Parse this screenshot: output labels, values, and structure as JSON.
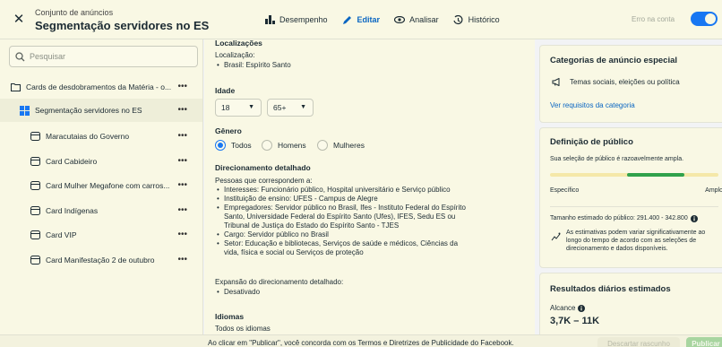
{
  "header": {
    "close_icon": "close-icon",
    "subtitle": "Conjunto de anúncios",
    "title": "Segmentação servidores no ES",
    "tabs": [
      {
        "label": "Desempenho",
        "icon": "bar-chart-icon"
      },
      {
        "label": "Editar",
        "icon": "pencil-icon",
        "active": true
      },
      {
        "label": "Analisar",
        "icon": "eye-icon"
      },
      {
        "label": "Histórico",
        "icon": "history-icon"
      }
    ],
    "error_label": "Erro na conta",
    "toggle_on": true,
    "accent_color": "#1877f2"
  },
  "sidebar": {
    "search_placeholder": "Pesquisar",
    "items": [
      {
        "label": "Cards de desdobramentos da Matéria - o...",
        "icon": "folder-icon",
        "level": 0
      },
      {
        "label": "Segmentação servidores no ES",
        "icon": "grid-icon",
        "level": 1,
        "selected": true
      },
      {
        "label": "Maracutaias do Governo",
        "icon": "ad-card-icon",
        "level": 2
      },
      {
        "label": "Card Cabideiro",
        "icon": "ad-card-icon",
        "level": 2
      },
      {
        "label": "Card Mulher Megafone com carros...",
        "icon": "ad-card-icon",
        "level": 2
      },
      {
        "label": "Card Indígenas",
        "icon": "ad-card-icon",
        "level": 2
      },
      {
        "label": "Card VIP",
        "icon": "ad-card-icon",
        "level": 2
      },
      {
        "label": "Card Manifestação 2 de outubro",
        "icon": "ad-card-icon",
        "level": 2
      }
    ],
    "more_label": "•••"
  },
  "main": {
    "locations_title": "Localizações",
    "location_label": "Localização:",
    "location_value": "Brasil: Espírito Santo",
    "age_title": "Idade",
    "age_min": "18",
    "age_max": "65+",
    "gender_title": "Gênero",
    "gender_options": [
      "Todos",
      "Homens",
      "Mulheres"
    ],
    "gender_selected": "Todos",
    "detailed_title": "Direcionamento detalhado",
    "detailed_intro": "Pessoas que correspondem a:",
    "detailed_items": [
      "Interesses: Funcionário público, Hospital universitário e Serviço público",
      "Instituição de ensino: UFES - Campus de Alegre",
      "Empregadores: Servidor público no Brasil, Ifes - Instituto Federal do Espírito",
      "Santo, Universidade Federal do Espírito Santo (Ufes), IFES, Sedu ES ou",
      "Tribunal de Justiça do Estado do Espírito Santo - TJES",
      "Cargo: Servidor público no Brasil",
      "Setor: Educação e bibliotecas, Serviços de saúde e médicos, Ciências da",
      "vida, física e social ou Serviços de proteção"
    ],
    "expansion_label": "Expansão do direcionamento detalhado:",
    "expansion_value": "Desativado",
    "languages_title": "Idiomas",
    "languages_value": "Todos os idiomas"
  },
  "right": {
    "special_title": "Categorias de anúncio especial",
    "special_item": "Temas sociais, eleições ou política",
    "special_link": "Ver requisitos da categoria",
    "audience_title": "Definição de público",
    "audience_desc": "Sua seleção de público é razoavelmente ampla.",
    "audience_level": 0.63,
    "meter_left": "Específico",
    "meter_right": "Amplo",
    "audience_size": "Tamanho estimado do público: 291.400 - 342.800",
    "audience_note_1": "As estimativas podem variar significativamente ao",
    "audience_note_2": "longo do tempo de acordo com as seleções de",
    "audience_note_3": "direcionamento e dados disponíveis.",
    "daily_title": "Resultados diários estimados",
    "reach_label": "Alcance",
    "reach_value": "3,7K – 11K"
  },
  "footer": {
    "note": "Ao clicar em \"Publicar\", você concorda com os Termos e Diretrizes de Publicidade do Facebook.",
    "discard_label": "Descartar rascunho",
    "publish_label": "Publicar"
  }
}
